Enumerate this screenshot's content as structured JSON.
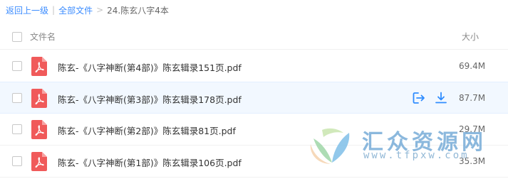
{
  "breadcrumb": {
    "back_label": "返回上一级",
    "separator": "|",
    "all_files_label": "全部文件",
    "arrow": ">",
    "current_folder": "24.陈玄八字4本"
  },
  "header": {
    "name_label": "文件名",
    "size_label": "大小"
  },
  "files": [
    {
      "name": "陈玄-《八字神断(第4部)》陈玄辑录151页.pdf",
      "size": "69.4M",
      "icon": "pdf-icon"
    },
    {
      "name": "陈玄-《八字神断(第3部)》陈玄辑录178页.pdf",
      "size": "87.7M",
      "icon": "pdf-icon"
    },
    {
      "name": "陈玄-《八字神断(第2部)》陈玄辑录81页.pdf",
      "size": "29.7M",
      "icon": "pdf-icon"
    },
    {
      "name": "陈玄-《八字神断(第1部)》陈玄辑录106页.pdf",
      "size": "35.3M",
      "icon": "pdf-icon"
    }
  ],
  "hover_actions": {
    "share_icon": "share-icon",
    "download_icon": "download-icon"
  },
  "watermark": {
    "title": "汇众资源网",
    "url": "www.tfpxw.com"
  },
  "colors": {
    "link": "#3b8cff",
    "pdf_red": "#f05a5a",
    "hover_bg": "#f2f8ff",
    "action_blue": "#2f8cff"
  }
}
